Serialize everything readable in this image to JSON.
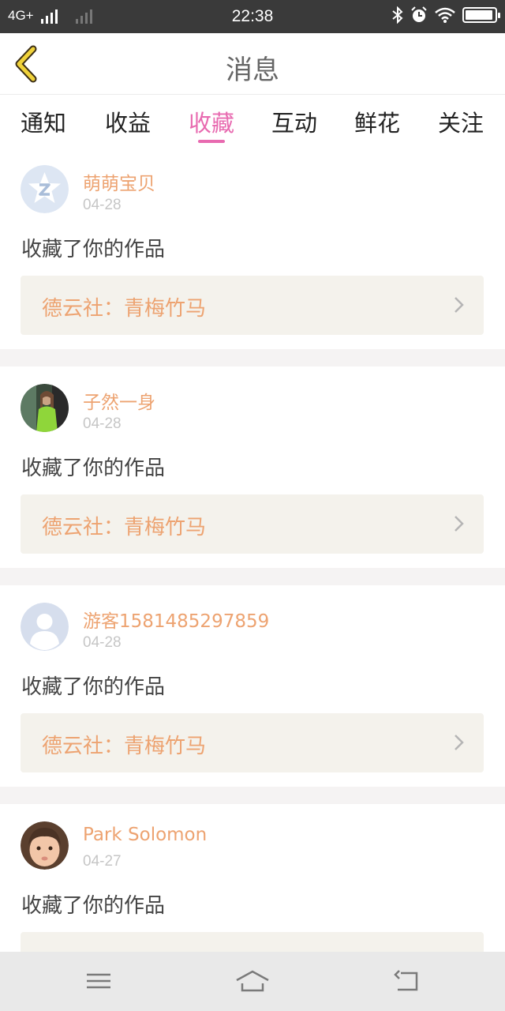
{
  "status_bar": {
    "network": "4G+",
    "time": "22:38",
    "battery_level": 0.95,
    "icons": [
      "signal-icon",
      "bluetooth-icon",
      "alarm-icon",
      "wifi-icon",
      "battery-icon"
    ]
  },
  "header": {
    "title": "消息",
    "back_icon": "chevron-left-icon"
  },
  "tabs": [
    {
      "label": "通知",
      "active": false
    },
    {
      "label": "收益",
      "active": false
    },
    {
      "label": "收藏",
      "active": true
    },
    {
      "label": "互动",
      "active": false
    },
    {
      "label": "鲜花",
      "active": false
    },
    {
      "label": "关注",
      "active": false
    }
  ],
  "messages": [
    {
      "name": "萌萌宝贝",
      "date": "04-28",
      "action": "收藏了你的作品",
      "work": "德云社：青梅竹马",
      "avatar": "qzone-default-avatar"
    },
    {
      "name": "子然一身",
      "date": "04-28",
      "action": "收藏了你的作品",
      "work": "德云社：青梅竹马",
      "avatar": "user-photo-avatar"
    },
    {
      "name": "游客1581485297859",
      "date": "04-28",
      "action": "收藏了你的作品",
      "work": "德云社：青梅竹马",
      "avatar": "guest-default-avatar"
    },
    {
      "name": "Park Solomon",
      "date": "04-27",
      "action": "收藏了你的作品",
      "work": "",
      "avatar": "child-photo-avatar"
    }
  ],
  "colors": {
    "accent": "#e86ab0",
    "username": "#eda371",
    "work_bg": "#f4f2ec",
    "status_bar": "#3a3a3a"
  },
  "system_nav": [
    "menu-icon",
    "home-icon",
    "back-icon"
  ]
}
